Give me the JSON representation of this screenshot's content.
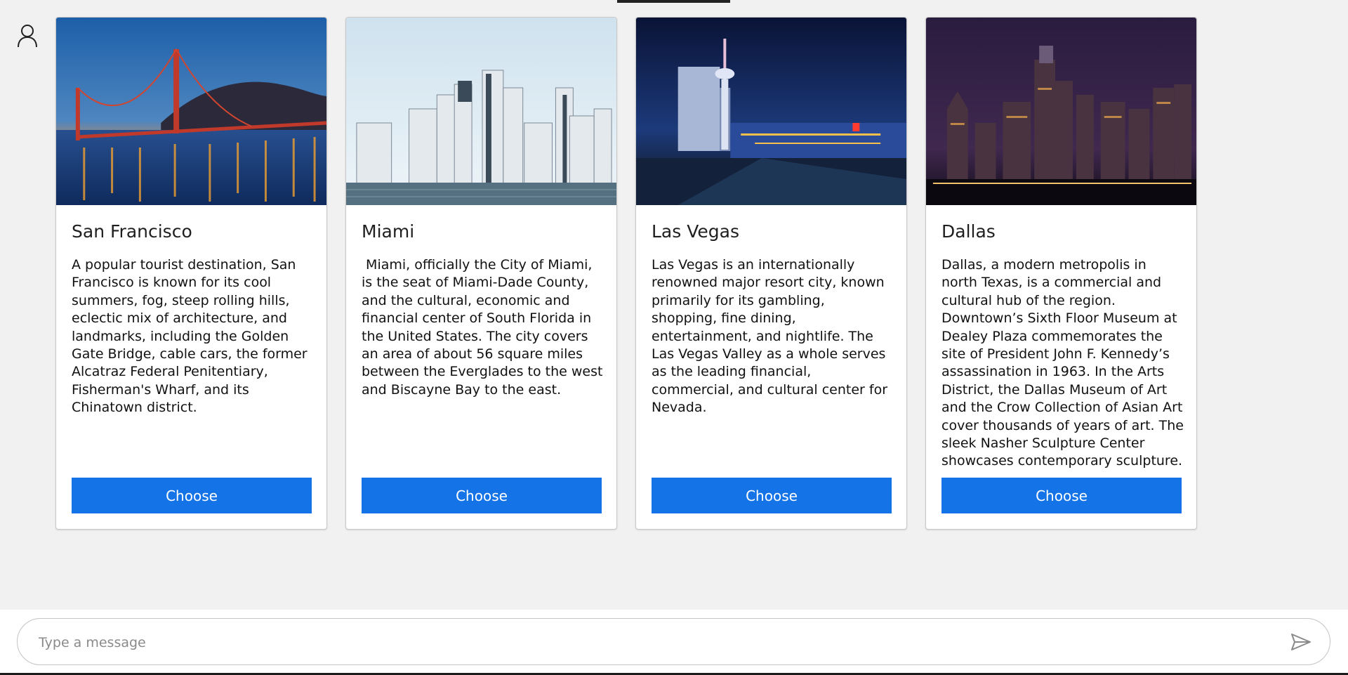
{
  "header": {
    "avatar_icon": "user-icon"
  },
  "cards": [
    {
      "title": "San Francisco",
      "description": "A popular tourist destination, San Francisco is known for its cool summers, fog, steep rolling hills, eclectic mix of architecture, and landmarks, including the Golden Gate Bridge, cable cars, the former Alcatraz Federal Penitentiary, Fisherman's Wharf, and its Chinatown district.",
      "button_label": "Choose"
    },
    {
      "title": "Miami",
      "description": " Miami, officially the City of Miami, is the seat of Miami-Dade County, and the cultural, economic and financial center of South Florida in the United States. The city covers an area of about 56 square miles between the Everglades to the west and Biscayne Bay to the east.",
      "button_label": "Choose"
    },
    {
      "title": "Las Vegas",
      "description": "Las Vegas is an internationally renowned major resort city, known primarily for its gambling, shopping, fine dining, entertainment, and nightlife. The Las Vegas Valley as a whole serves as the leading financial, commercial, and cultural center for Nevada.",
      "button_label": "Choose"
    },
    {
      "title": "Dallas",
      "description": "Dallas, a modern metropolis in north Texas, is a commercial and cultural hub of the region. Downtown’s Sixth Floor Museum at Dealey Plaza commemorates the site of President John F. Kennedy’s assassination in 1963. In the Arts District, the Dallas Museum of Art and the Crow Collection of Asian Art cover thousands of years of art. The sleek Nasher Sculpture Center showcases contemporary sculpture.",
      "button_label": "Choose"
    }
  ],
  "composer": {
    "placeholder": "Type a message",
    "value": "",
    "send_icon": "send-icon"
  },
  "colors": {
    "accent": "#1473e6",
    "background": "#f1f1f1"
  }
}
